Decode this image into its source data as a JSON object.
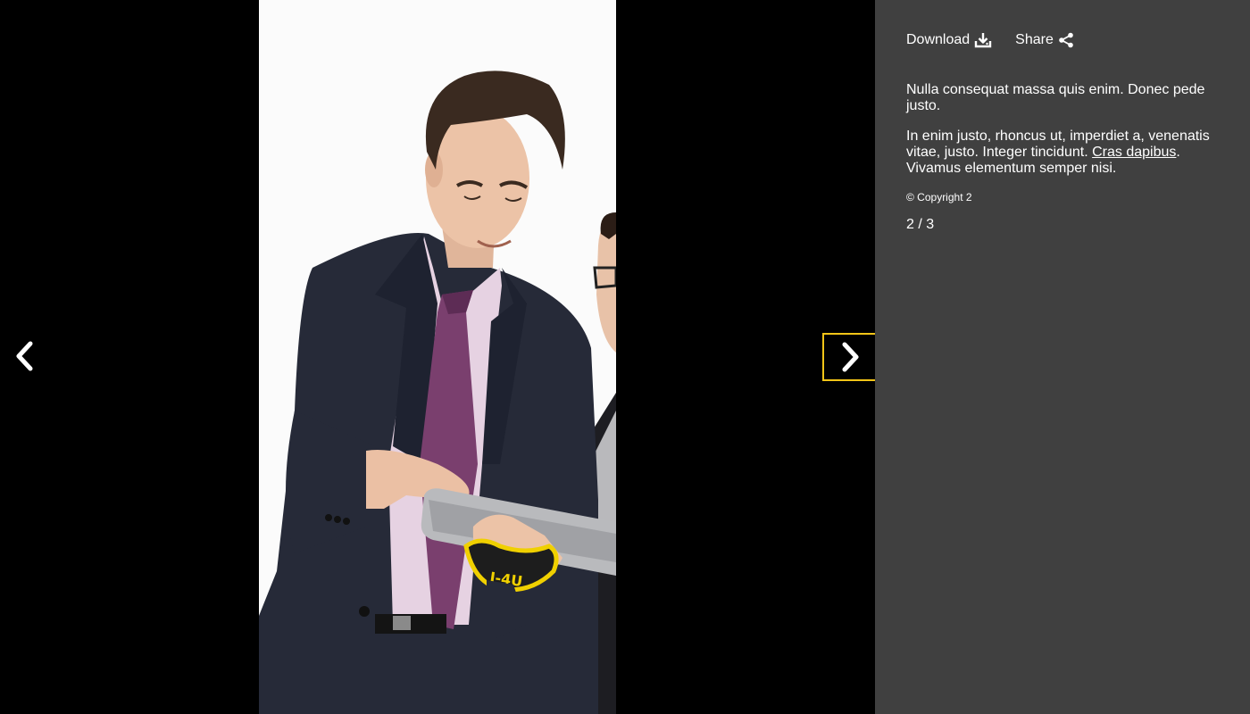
{
  "toolbar": {
    "download_label": "Download",
    "download_icon": "download-icon",
    "share_label": "Share",
    "share_icon": "share-icon"
  },
  "caption": {
    "paragraph1": "Nulla consequat massa quis enim. Donec pede justo.",
    "paragraph2_text": "In enim justo, rhoncus ut, imperdiet a, venenatis vitae, justo. Integer tincidunt. ",
    "paragraph2_link": "Cras dapibus",
    "paragraph2_tail": ". Vivamus elementum semper nisi.",
    "copyright": "© Copyright 2"
  },
  "counter": "2 / 3",
  "nav": {
    "prev_icon": "chevron-left-icon",
    "next_icon": "chevron-right-icon"
  },
  "colors": {
    "stage_bg": "#000000",
    "panel_bg": "#404040",
    "focus_outline": "#f5c518",
    "text": "#ffffff"
  }
}
